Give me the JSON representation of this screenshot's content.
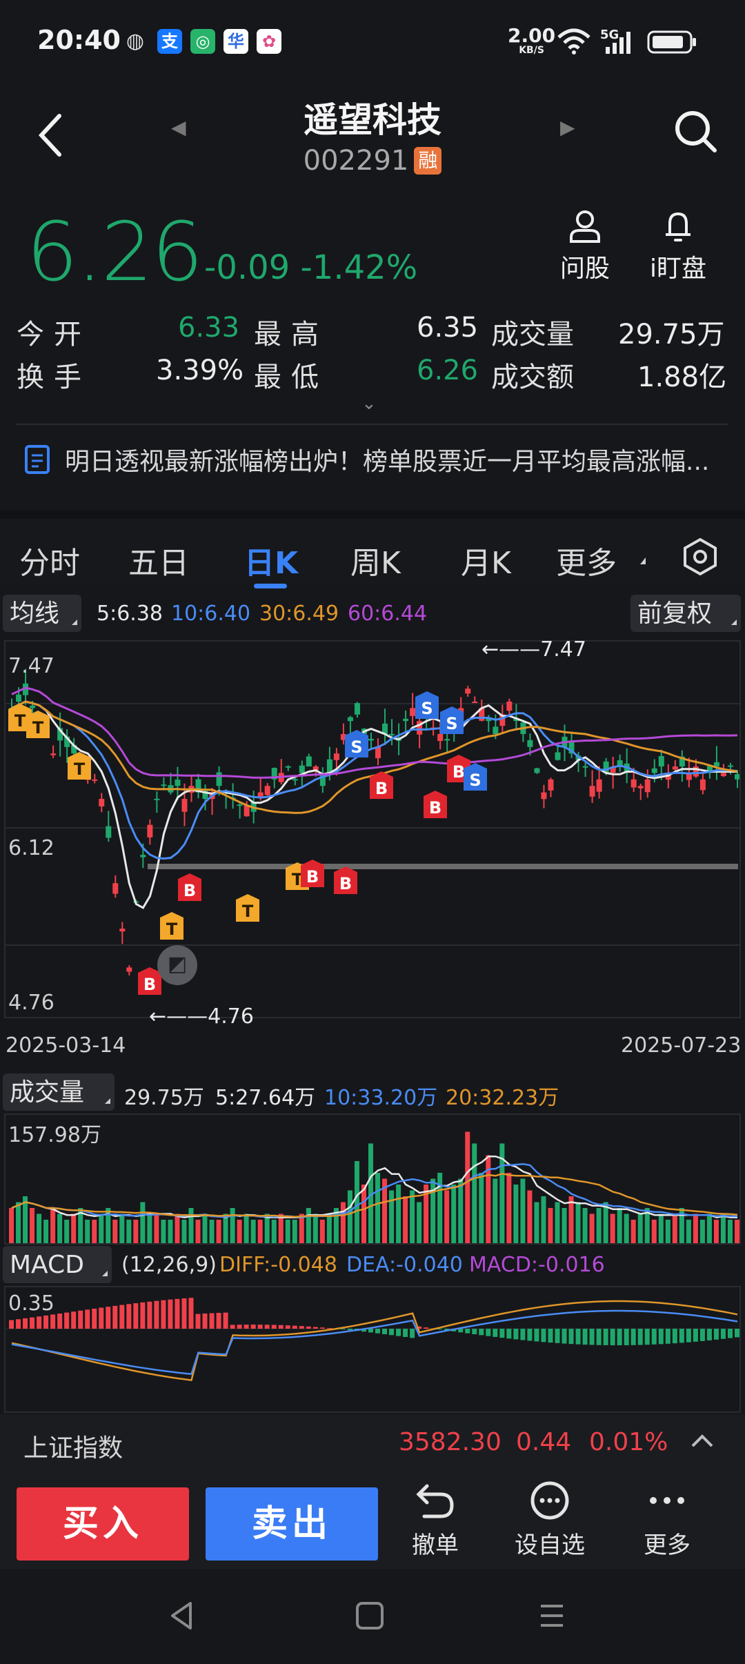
{
  "status": {
    "time": "20:40",
    "net_speed": "2.00",
    "net_unit": "KB/S",
    "signal": "5G",
    "icons": [
      "wechat-icon",
      "alipay-icon",
      "app-icon",
      "app-icon",
      "app-icon"
    ]
  },
  "header": {
    "title": "遥望科技",
    "code": "002291",
    "badge": "融"
  },
  "quote": {
    "price": "6.26",
    "change": "-0.09",
    "change_pct": "-1.42%",
    "tools": [
      {
        "label": "问股",
        "icon": "person-icon"
      },
      {
        "label": "i盯盘",
        "icon": "bell-icon"
      }
    ],
    "rows": [
      {
        "l1": "今开",
        "v1": "6.33",
        "l2": "最高",
        "v2": "6.35",
        "l3": "成交量",
        "v3": "29.75万"
      },
      {
        "l1": "换手",
        "v1": "3.39%",
        "l2": "最低",
        "v2": "6.26",
        "l3": "成交额",
        "v3": "1.88亿"
      }
    ]
  },
  "news": {
    "text": "明日透视最新涨幅榜出炉！榜单股票近一月平均最高涨幅..."
  },
  "tabs": [
    "分时",
    "五日",
    "日K",
    "周K",
    "月K",
    "更多"
  ],
  "active_tab": "日K",
  "ma_legend": {
    "chip": "均线",
    "items": [
      {
        "text": "5:6.38",
        "color": "#e8e8e8"
      },
      {
        "text": "10:6.40",
        "color": "#4a8cf5"
      },
      {
        "text": "30:6.49",
        "color": "#e0962a"
      },
      {
        "text": "60:6.44",
        "color": "#b54ad8"
      }
    ],
    "adjust": "前复权"
  },
  "kline": {
    "y_top": "7.47",
    "y_mid": "6.12",
    "y_bottom": "4.76",
    "high_marker": "7.47",
    "low_marker": "4.76",
    "date_start": "2025-03-14",
    "date_end": "2025-07-23"
  },
  "volume": {
    "chip": "成交量",
    "items": [
      {
        "text": "29.75万",
        "color": "#e0e0e0"
      },
      {
        "text": "5:27.64万",
        "color": "#e8e8e8"
      },
      {
        "text": "10:33.20万",
        "color": "#4a8cf5"
      },
      {
        "text": "20:32.23万",
        "color": "#e0962a"
      }
    ],
    "y_top": "157.98万"
  },
  "macd": {
    "chip": "MACD",
    "items": [
      {
        "text": "(12,26,9)",
        "color": "#e0e0e0"
      },
      {
        "text": "DIFF:-0.048",
        "color": "#e0962a"
      },
      {
        "text": "DEA:-0.040",
        "color": "#4a8cf5"
      },
      {
        "text": "MACD:-0.016",
        "color": "#b54ad8"
      }
    ],
    "y_top": "0.35"
  },
  "index": {
    "name": "上证指数",
    "value": "3582.30",
    "change": "0.44",
    "pct": "0.01%"
  },
  "actions": {
    "buy": "买入",
    "sell": "卖出",
    "items": [
      {
        "label": "撤单",
        "icon": "undo-icon"
      },
      {
        "label": "设自选",
        "icon": "more-circle-icon"
      },
      {
        "label": "更多",
        "icon": "dots-icon"
      }
    ]
  },
  "colors": {
    "up": "#f0414a",
    "down": "#1fa86c",
    "accent": "#3a82f7",
    "buy": "#e9353f",
    "sell": "#3a7cf6"
  }
}
